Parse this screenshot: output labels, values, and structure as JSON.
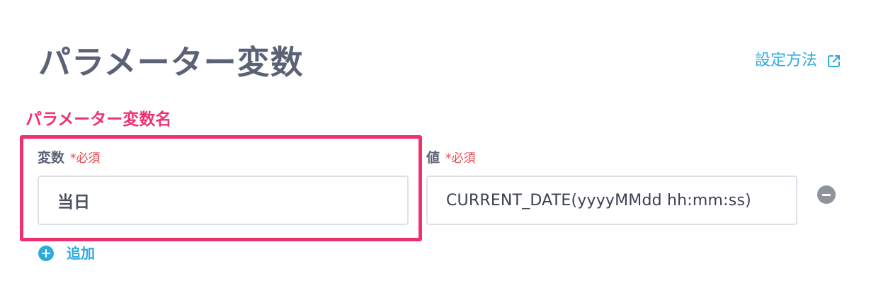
{
  "page": {
    "title": "パラメーター変数",
    "help_link": "設定方法"
  },
  "annotation": {
    "label": "パラメーター変数名",
    "color": "#f0316f"
  },
  "fields": {
    "key": {
      "label": "変数",
      "required": "*必須",
      "value": "当日"
    },
    "value": {
      "label": "値",
      "required": "*必須",
      "value": "CURRENT_DATE(yyyyMMdd hh:mm:ss)"
    }
  },
  "actions": {
    "add_label": "追加",
    "remove_icon": "minus-circle-icon",
    "add_icon": "plus-circle-icon",
    "external_icon": "external-link-icon"
  },
  "colors": {
    "accent": "#2eaadc",
    "heading": "#5b6275",
    "required": "#e8474d"
  }
}
